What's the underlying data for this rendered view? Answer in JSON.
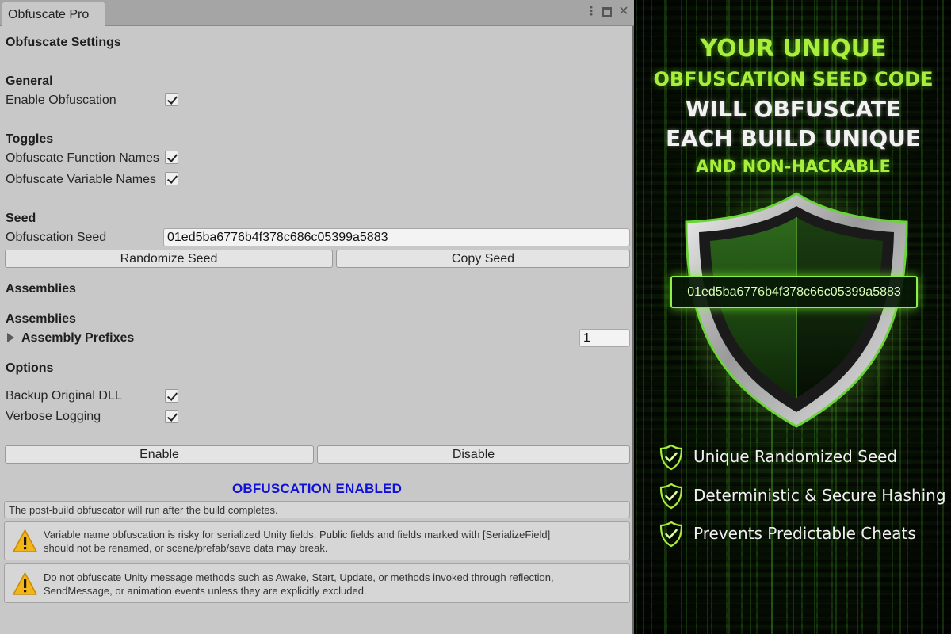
{
  "window": {
    "tab_title": "Obfuscate Pro"
  },
  "settings": {
    "title": "Obfuscate Settings",
    "general": {
      "header": "General",
      "enable_label": "Enable Obfuscation",
      "enable_checked": true
    },
    "toggles": {
      "header": "Toggles",
      "function_names_label": "Obfuscate Function Names",
      "function_names_checked": true,
      "variable_names_label": "Obfuscate Variable Names",
      "variable_names_checked": true
    },
    "seed": {
      "header": "Seed",
      "label": "Obfuscation Seed",
      "value": "01ed5ba6776b4f378c686c05399a5883",
      "randomize_button": "Randomize Seed",
      "copy_button": "Copy Seed"
    },
    "assemblies": {
      "section_header": "Assemblies",
      "header": "Assemblies",
      "prefixes_label": "Assembly Prefixes",
      "prefixes_count": "1"
    },
    "options": {
      "header": "Options",
      "backup_label": "Backup Original DLL",
      "backup_checked": true,
      "verbose_label": "Verbose Logging",
      "verbose_checked": true
    },
    "actions": {
      "enable_button": "Enable",
      "disable_button": "Disable"
    },
    "status": {
      "text": "OBFUSCATION ENABLED",
      "color": "#1010d8"
    },
    "info": "The post-build obfuscator will run after the build completes.",
    "warnings": [
      {
        "line1": "Variable name obfuscation is risky for serialized Unity fields. Public fields and fields marked with [SerializeField]",
        "line2": "should not be renamed, or scene/prefab/save data may break."
      },
      {
        "line1": "Do not obfuscate Unity message methods such as Awake, Start, Update, or methods invoked through reflection,",
        "line2": "SendMessage, or animation events unless they are explicitly excluded."
      }
    ]
  },
  "promo": {
    "line1": "YOUR UNIQUE",
    "line2": "OBFUSCATION SEED CODE",
    "line3": "WILL OBFUSCATE",
    "line4": "EACH BUILD UNIQUE",
    "line5": "AND NON-HACKABLE",
    "seed_code": "01ed5ba6776b4f378c66c05399a5883",
    "features": [
      "Unique Randomized Seed",
      "Deterministic & Secure Hashing",
      "Prevents Predictable Cheats"
    ],
    "accent_color": "#a8ee3a",
    "icons": {
      "shield": "shield-icon",
      "feature": "shield-check-icon"
    }
  }
}
